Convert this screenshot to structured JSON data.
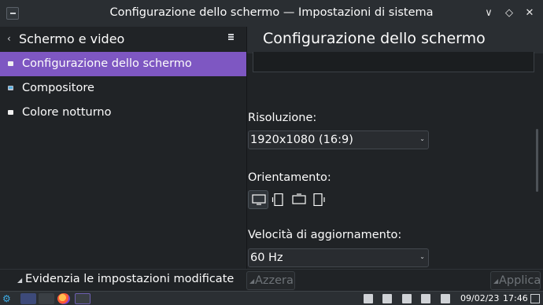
{
  "window": {
    "title": "Configurazione dello schermo — Impostazioni di sistema",
    "buttons": {
      "minimize": "∨",
      "maximize": "◇",
      "close": "✕"
    }
  },
  "sidebar": {
    "back_label": "‹",
    "title": "Schermo e video",
    "items": [
      {
        "label": "Configurazione dello schermo",
        "icon": "monitor-icon",
        "active": true
      },
      {
        "label": "Compositore",
        "icon": "compositor-icon",
        "active": false
      },
      {
        "label": "Colore notturno",
        "icon": "night-color-icon",
        "active": false
      }
    ]
  },
  "main": {
    "title": "Configurazione dello schermo",
    "resolution": {
      "label": "Risoluzione:",
      "value": "1920x1080 (16:9)"
    },
    "orientation": {
      "label": "Orientamento:",
      "options": [
        "landscape",
        "portrait",
        "landscape-flipped",
        "portrait-flipped"
      ],
      "selected": 0
    },
    "refresh": {
      "label": "Velocità di aggiornamento:",
      "value": "60 Hz"
    }
  },
  "footer": {
    "highlight_label": "Evidenzia le impostazioni modificate",
    "reset_label": "Azzera",
    "apply_label": "Applica"
  },
  "taskbar": {
    "date": "09/02/23",
    "time": "17:46"
  },
  "colors": {
    "accent": "#7e57c2",
    "background": "#202326",
    "header": "#2a2e32"
  }
}
